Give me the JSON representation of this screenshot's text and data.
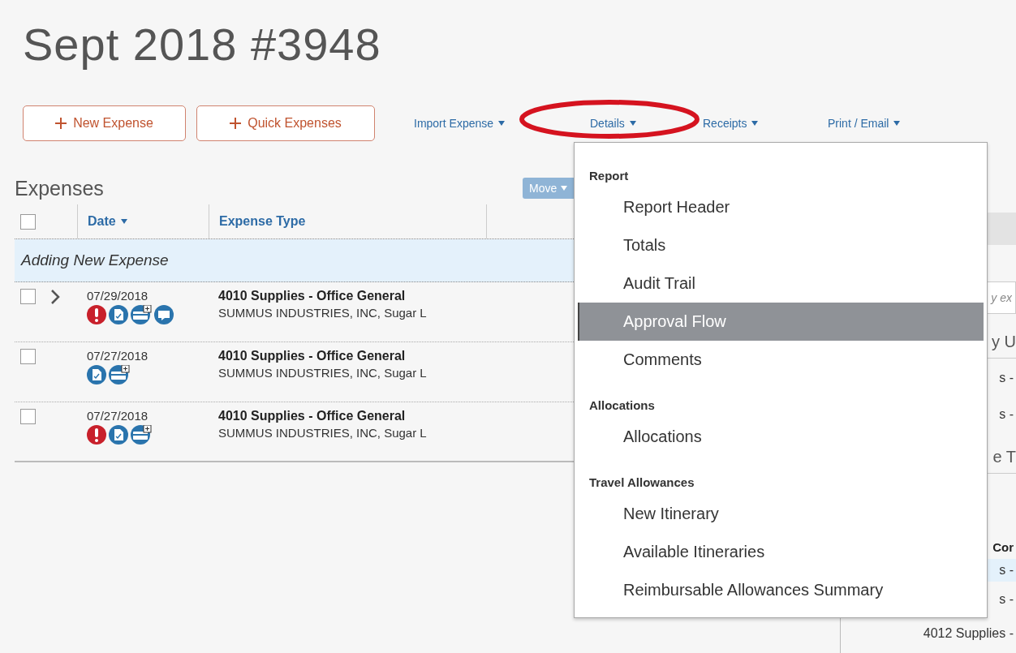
{
  "title": "Sept 2018 #3948",
  "toolbar": {
    "buttons": [
      {
        "label": "New Expense"
      },
      {
        "label": "Quick Expenses"
      }
    ],
    "links": [
      {
        "label": "Import Expense",
        "circled": false
      },
      {
        "label": "Details",
        "circled": true,
        "open": true,
        "menu": [
          {
            "heading": "Report",
            "items": [
              {
                "label": "Report Header",
                "selected": false
              },
              {
                "label": "Totals",
                "selected": false
              },
              {
                "label": "Audit Trail",
                "selected": false
              },
              {
                "label": "Approval Flow",
                "selected": true
              },
              {
                "label": "Comments",
                "selected": false
              }
            ]
          },
          {
            "heading": "Allocations",
            "items": [
              {
                "label": "Allocations",
                "selected": false
              }
            ]
          },
          {
            "heading": "Travel Allowances",
            "items": [
              {
                "label": "New Itinerary",
                "selected": false
              },
              {
                "label": "Available Itineraries",
                "selected": false
              },
              {
                "label": "Reimbursable Allowances Summary",
                "selected": false
              }
            ]
          }
        ]
      },
      {
        "label": "Receipts",
        "circled": false
      },
      {
        "label": "Print / Email",
        "circled": false
      }
    ]
  },
  "expenses": {
    "heading": "Expenses",
    "move_button": {
      "label": "Move",
      "disabled": true
    },
    "select_all_checked": false,
    "columns": [
      "Date",
      "Expense Type"
    ],
    "adding_row": "Adding New Expense",
    "rows": [
      {
        "checked": false,
        "expandable": true,
        "date": "07/29/2018",
        "type": "4010 Supplies - Office General",
        "vendor": "SUMMUS INDUSTRIES, INC, Sugar L",
        "icons": [
          {
            "kind": "alert"
          },
          {
            "kind": "receipt"
          },
          {
            "kind": "card"
          },
          {
            "kind": "comment"
          }
        ]
      },
      {
        "checked": false,
        "expandable": false,
        "date": "07/27/2018",
        "type": "4010 Supplies - Office General",
        "vendor": "SUMMUS INDUSTRIES, INC, Sugar L",
        "icons": [
          {
            "kind": "receipt"
          },
          {
            "kind": "card"
          }
        ]
      },
      {
        "checked": false,
        "expandable": false,
        "date": "07/27/2018",
        "type": "4010 Supplies - Office General",
        "vendor": "SUMMUS INDUSTRIES, INC, Sugar L",
        "icons": [
          {
            "kind": "alert"
          },
          {
            "kind": "receipt"
          },
          {
            "kind": "card"
          }
        ]
      }
    ]
  },
  "side_panel": {
    "search_placeholder": "y ex",
    "heading_1": "y U",
    "items_1": [
      "s -",
      "s -"
    ],
    "heading_2": "e T",
    "column_heading": "Cor",
    "items_2": [
      {
        "text": "s -",
        "selected": true
      },
      {
        "text": "s -",
        "selected": false
      },
      {
        "text": "4012 Supplies -",
        "selected": false
      }
    ]
  }
}
